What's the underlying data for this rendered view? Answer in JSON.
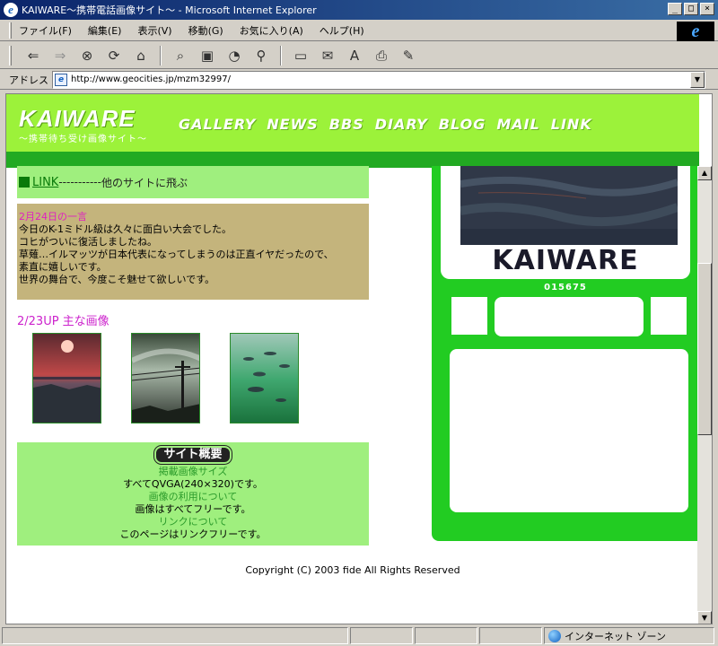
{
  "window": {
    "title": "KAIWARE～携帯電話画像サイト～ - Microsoft Internet Explorer",
    "controls": [
      "_",
      "□",
      "×"
    ]
  },
  "menu": [
    "ファイル(F)",
    "編集(E)",
    "表示(V)",
    "移動(G)",
    "お気に入り(A)",
    "ヘルプ(H)"
  ],
  "toolbar": {
    "icons": [
      "back-icon",
      "forward-icon",
      "stop-icon",
      "refresh-icon",
      "home-icon",
      "search-icon",
      "favorites-icon",
      "history-icon",
      "channels-icon",
      "fullscreen-icon",
      "mail-icon",
      "font-icon",
      "print-icon",
      "edit-icon"
    ]
  },
  "address": {
    "label": "アドレス",
    "url": "http://www.geocities.jp/mzm32997/"
  },
  "site": {
    "logo": "KAIWARE",
    "tagline": "～携帯待ち受け画像サイト～",
    "nav": [
      "GALLERY",
      "NEWS",
      "BBS",
      "DIARY",
      "BLOG",
      "MAIL",
      "LINK"
    ]
  },
  "link_section": {
    "link_text": "LINK",
    "dashes": "-----------",
    "description": "他のサイトに飛ぶ"
  },
  "news": {
    "title": "2月24日の一言",
    "lines": [
      "今日のK-1ミドル級は久々に面白い大会でした。",
      "コヒがついに復活しましたね。",
      "草薙…イルマッツが日本代表になってしまうのは正直イヤだったので、",
      "素直に嬉しいです。",
      "世界の舞台で、今度こそ魅せて欲しいです。"
    ]
  },
  "gallery": {
    "title": "2/23UP 主な画像",
    "thumbnails": [
      "sunset-image",
      "utility-pole-image",
      "fish-image"
    ]
  },
  "about": {
    "title": "サイト概要",
    "items": [
      {
        "heading": "掲載画像サイズ",
        "text": "すべてQVGA(240×320)です。"
      },
      {
        "heading": "画像の利用について",
        "text": "画像はすべてフリーです。"
      },
      {
        "heading": "リンクについて",
        "text": "このページはリンクフリーです。"
      }
    ]
  },
  "copyright": "Copyright (C) 2003 fide All Rights Reserved",
  "sidebar": {
    "mark": "KAIWARE",
    "counter": "015675"
  },
  "status": {
    "zone": "インターネット ゾーン"
  },
  "colors": {
    "header": "#9cf23a",
    "header_band": "#22aa22",
    "sidebar": "#22cc22",
    "light_green": "#9fef7e",
    "news_bg": "#c4b47c",
    "accent_pink": "#cc22cc"
  }
}
